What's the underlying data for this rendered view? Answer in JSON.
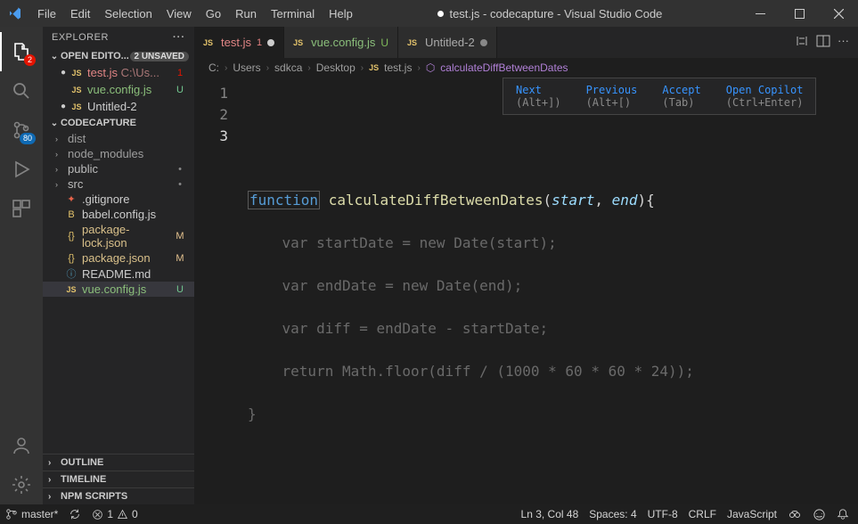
{
  "menu": {
    "file": "File",
    "edit": "Edit",
    "selection": "Selection",
    "view": "View",
    "go": "Go",
    "run": "Run",
    "terminal": "Terminal",
    "help": "Help"
  },
  "window_title": "test.js - codecapture - Visual Studio Code",
  "explorer": {
    "title": "EXPLORER",
    "open_editors_label": "OPEN EDITO...",
    "unsaved_badge": "2 UNSAVED",
    "open_editors": [
      {
        "name": "test.js",
        "path": "C:\\Us...",
        "status": "1",
        "icon": "js",
        "dirty": true
      },
      {
        "name": "vue.config.js",
        "status": "U",
        "icon": "js",
        "dirty": false
      },
      {
        "name": "Untitled-2",
        "status": "",
        "icon": "js",
        "dirty": true
      }
    ],
    "workspace_name": "CODECAPTURE",
    "tree": [
      {
        "name": "dist",
        "kind": "folder"
      },
      {
        "name": "node_modules",
        "kind": "folder"
      },
      {
        "name": "public",
        "kind": "folder",
        "status": "•"
      },
      {
        "name": "src",
        "kind": "folder",
        "status": "•"
      },
      {
        "name": ".gitignore",
        "kind": "file",
        "icon": "gitignore"
      },
      {
        "name": "babel.config.js",
        "kind": "file",
        "icon": "babel"
      },
      {
        "name": "package-lock.json",
        "kind": "file",
        "icon": "curly",
        "status": "M"
      },
      {
        "name": "package.json",
        "kind": "file",
        "icon": "curly",
        "status": "M"
      },
      {
        "name": "README.md",
        "kind": "file",
        "icon": "md"
      },
      {
        "name": "vue.config.js",
        "kind": "file",
        "icon": "js",
        "status": "U",
        "selected": true
      }
    ],
    "outline": "OUTLINE",
    "timeline": "TIMELINE",
    "npm_scripts": "NPM SCRIPTS"
  },
  "activity_badges": {
    "explorer": "2",
    "scm": "80"
  },
  "tabs": [
    {
      "name": "test.js",
      "icon": "js",
      "badge": "1",
      "dirty": true,
      "active": true
    },
    {
      "name": "vue.config.js",
      "icon": "js",
      "suffix": "U"
    },
    {
      "name": "Untitled-2",
      "icon": "js",
      "dirty": true
    }
  ],
  "breadcrumb": [
    "C:",
    "Users",
    "sdkca",
    "Desktop",
    "test.js",
    "calculateDiffBetweenDates"
  ],
  "code": {
    "line_numbers": [
      "1",
      "2",
      "3"
    ],
    "func_kw": "function",
    "func_name": "calculateDiffBetweenDates",
    "arg1": "start",
    "arg2": "end",
    "ghost_lines": [
      "    var startDate = new Date(start);",
      "    var endDate = new Date(end);",
      "    var diff = endDate - startDate;",
      "    return Math.floor(diff / (1000 * 60 * 60 * 24));",
      "}"
    ]
  },
  "suggest": {
    "next": "Next",
    "next_sc": "(Alt+])",
    "prev": "Previous",
    "prev_sc": "(Alt+[)",
    "accept": "Accept",
    "accept_sc": "(Tab)",
    "open": "Open Copilot",
    "open_sc": "(Ctrl+Enter)"
  },
  "status": {
    "branch": "master*",
    "sync": "",
    "errors": "1",
    "warnings": "0",
    "cursor": "Ln 3, Col 48",
    "spaces": "Spaces: 4",
    "encoding": "UTF-8",
    "eol": "CRLF",
    "lang": "JavaScript"
  }
}
